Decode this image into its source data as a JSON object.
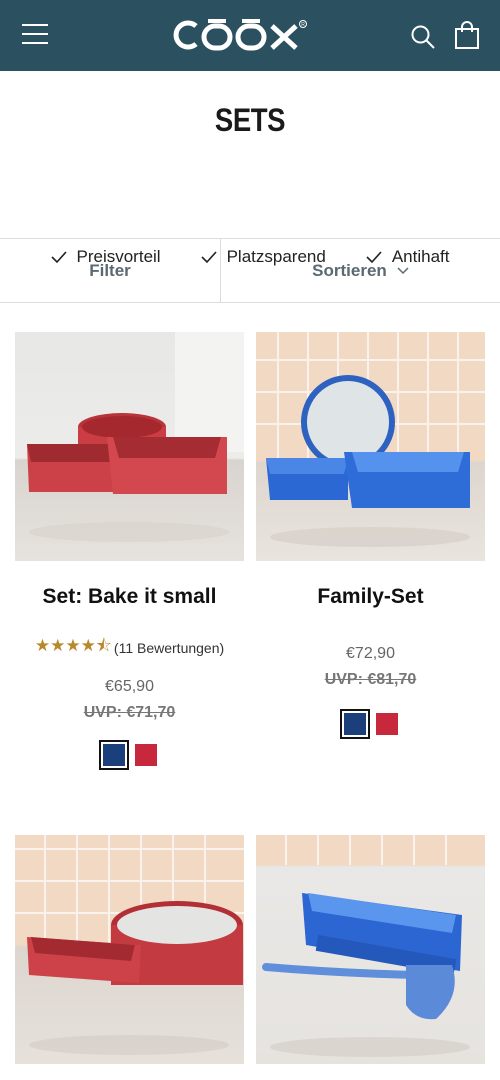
{
  "header": {
    "logo_text": "COOX",
    "bg_color": "#2b5160"
  },
  "page": {
    "title": "SETS"
  },
  "usps": [
    "Preisvorteil",
    "Platzsparend",
    "Antihaft"
  ],
  "toolbar": {
    "filter_label": "Filter",
    "sort_label": "Sortieren"
  },
  "products": [
    {
      "name": "Set: Bake it small",
      "rating_text": "(11 Bewertungen)",
      "rating": 4.5,
      "price": "€65,90",
      "uvp": "UVP: €71,70",
      "swatches": [
        "#1a3f7a",
        "#c8283c"
      ],
      "image_theme": "red"
    },
    {
      "name": "Family-Set",
      "price": "€72,90",
      "uvp": "UVP: €81,70",
      "swatches": [
        "#1a3f7a",
        "#c8283c"
      ],
      "image_theme": "blue"
    },
    {
      "name": "",
      "image_theme": "red"
    },
    {
      "name": "",
      "image_theme": "blue"
    }
  ],
  "colors": {
    "accent_star": "#b8892a",
    "swatch_blue": "#1a3f7a",
    "swatch_red": "#c8283c"
  }
}
